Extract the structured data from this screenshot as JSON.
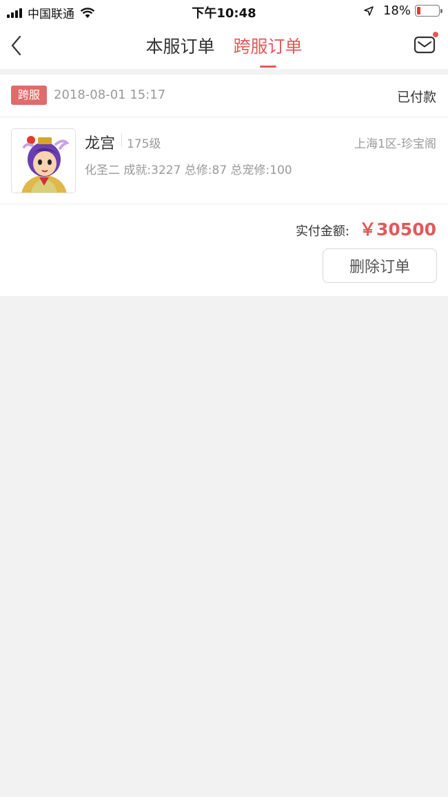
{
  "status_bar": {
    "carrier": "中国联通",
    "time": "下午10:48",
    "battery_percent": "18%",
    "battery_level": 0.18,
    "battery_color": "#e53935"
  },
  "nav": {
    "tabs": [
      {
        "label": "本服订单",
        "active": false
      },
      {
        "label": "跨服订单",
        "active": true
      }
    ],
    "accent_color": "#e05a5a",
    "back_icon": "chevron-left-icon",
    "mail_icon": "mail-icon",
    "has_notification": true
  },
  "order": {
    "tag": "跨服",
    "datetime": "2018-08-01 15:17",
    "status": "已付款",
    "item": {
      "name": "龙宫",
      "level": "175级",
      "server": "上海1区-珍宝阁",
      "detail": "化圣二 成就:3227 总修:87 总宠修:100"
    },
    "amount_label": "实付金额:",
    "amount_value": "￥30500",
    "delete_button": "删除订单"
  }
}
